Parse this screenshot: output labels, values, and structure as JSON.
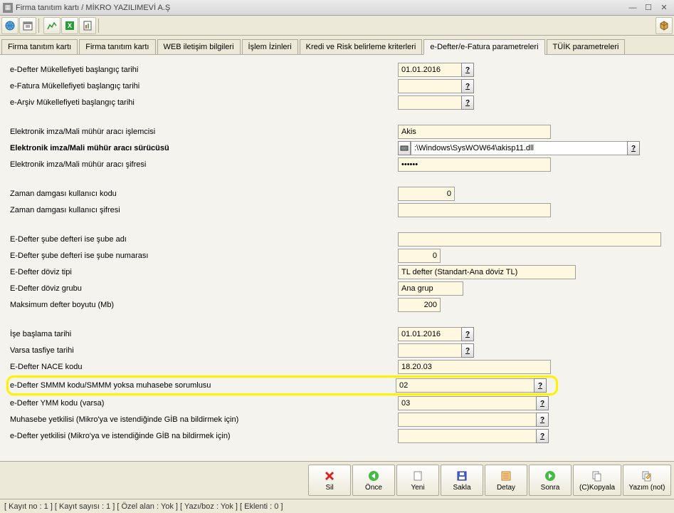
{
  "window": {
    "title": "Firma tanıtım kartı / MİKRO YAZILIMEVİ A.Ş"
  },
  "tabs": [
    {
      "label": "Firma tanıtım kartı",
      "active": false
    },
    {
      "label": "Firma tanıtım kartı",
      "active": false
    },
    {
      "label": "WEB iletişim bilgileri",
      "active": false
    },
    {
      "label": "İşlem İzinleri",
      "active": false
    },
    {
      "label": "Kredi ve Risk belirleme kriterleri",
      "active": false
    },
    {
      "label": "e-Defter/e-Fatura parametreleri",
      "active": true
    },
    {
      "label": "TÜİK parametreleri",
      "active": false
    }
  ],
  "fields": {
    "edefter_start": {
      "label": "e-Defter Mükellefiyeti başlangıç tarihi",
      "value": "01.01.2016"
    },
    "efatura_start": {
      "label": "e-Fatura Mükellefiyeti başlangıç tarihi",
      "value": ""
    },
    "earsiv_start": {
      "label": "e-Arşiv Mükellefiyeti başlangıç tarihi",
      "value": ""
    },
    "imza_islemci": {
      "label": "Elektronik imza/Mali mühür aracı işlemcisi",
      "value": "Akis"
    },
    "imza_surucu": {
      "label": "Elektronik imza/Mali mühür aracı sürücüsü",
      "value": ":\\Windows\\SysWOW64\\akisp11.dll"
    },
    "imza_sifre": {
      "label": "Elektronik imza/Mali mühür aracı şifresi",
      "value": "••••••"
    },
    "zaman_kod": {
      "label": "Zaman damgası kullanıcı kodu",
      "value": "0"
    },
    "zaman_sifre": {
      "label": "Zaman damgası kullanıcı şifresi",
      "value": ""
    },
    "sube_adi": {
      "label": "E-Defter şube defteri ise şube adı",
      "value": ""
    },
    "sube_no": {
      "label": "E-Defter şube defteri ise şube numarası",
      "value": "0"
    },
    "doviz_tipi": {
      "label": "E-Defter döviz tipi",
      "value": "TL defter (Standart-Ana döviz TL)"
    },
    "doviz_grup": {
      "label": "E-Defter döviz grubu",
      "value": "Ana grup"
    },
    "max_boyut": {
      "label": "Maksimum defter boyutu (Mb)",
      "value": "200"
    },
    "is_baslama": {
      "label": "İşe başlama tarihi",
      "value": "01.01.2016"
    },
    "tasfiye": {
      "label": "Varsa tasfiye tarihi",
      "value": ""
    },
    "nace": {
      "label": "E-Defter NACE kodu",
      "value": "18.20.03"
    },
    "smmm": {
      "label": "e-Defter SMMM kodu/SMMM yoksa muhasebe sorumlusu",
      "value": "02"
    },
    "ymm": {
      "label": "e-Defter YMM kodu (varsa)",
      "value": "03"
    },
    "muhasebe_yetki": {
      "label": "Muhasebe yetkilisi (Mikro'ya ve istendiğinde GİB na bildirmek için)",
      "value": ""
    },
    "edefter_yetki": {
      "label": "e-Defter yetkilisi (Mikro'ya ve istendiğinde GİB na bildirmek için)",
      "value": ""
    }
  },
  "footer": {
    "sil": "Sil",
    "once": "Önce",
    "yeni": "Yeni",
    "sakla": "Sakla",
    "detay": "Detay",
    "sonra": "Sonra",
    "kopyala": "(C)Kopyala",
    "yazim": "Yazım (not)"
  },
  "statusbar": "[ Kayıt no : 1 ] [ Kayıt sayısı : 1 ] [ Özel alan : Yok ] [ Yazı/boz : Yok ] [ Eklenti : 0 ]"
}
